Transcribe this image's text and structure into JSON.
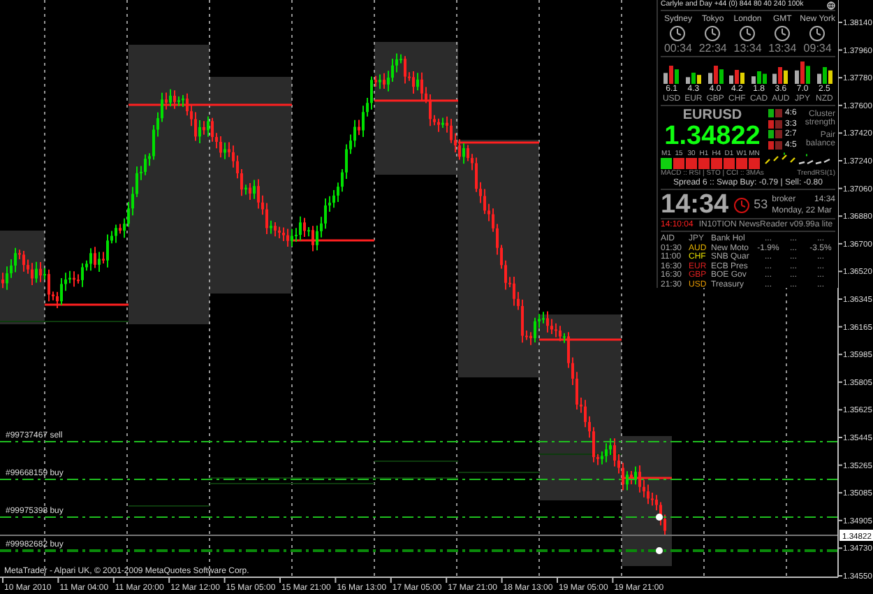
{
  "panel": {
    "header": "Carlyle and Day +44 (0) 844 80 40 240 100k",
    "clocks": [
      {
        "city": "Sydney",
        "time": "00:34"
      },
      {
        "city": "Tokyo",
        "time": "22:34"
      },
      {
        "city": "London",
        "time": "13:34"
      },
      {
        "city": "GMT",
        "time": "13:34"
      },
      {
        "city": "New York",
        "time": "09:34"
      }
    ],
    "strength": [
      {
        "value": "6.1",
        "code": "USD"
      },
      {
        "value": "4.3",
        "code": "EUR"
      },
      {
        "value": "4.0",
        "code": "GBP"
      },
      {
        "value": "4.2",
        "code": "CHF"
      },
      {
        "value": "1.8",
        "code": "CAD"
      },
      {
        "value": "3.6",
        "code": "AUD"
      },
      {
        "value": "7.0",
        "code": "JPY"
      },
      {
        "value": "2.5",
        "code": "NZD"
      }
    ],
    "pair": "EURUSD",
    "bid": "1.34822",
    "cluster": [
      {
        "ratio": "4:6"
      },
      {
        "ratio": "3:3"
      },
      {
        "ratio": "2:7"
      },
      {
        "ratio": "4:5"
      }
    ],
    "cluster_labels": [
      "Cluster strength",
      "Pair balance"
    ],
    "timeframes": [
      {
        "label": "M1",
        "bullish": true
      },
      {
        "label": "15",
        "bullish": false
      },
      {
        "label": "30",
        "bullish": false
      },
      {
        "label": "H1",
        "bullish": false
      },
      {
        "label": "H4",
        "bullish": false
      },
      {
        "label": "D1",
        "bullish": false
      },
      {
        "label": "W1",
        "bullish": false
      },
      {
        "label": "MN",
        "bullish": false
      }
    ],
    "indicators": "MACD :: RSI | STO | CCI :: 3MAs",
    "trend_label": "TrendRSI(1)",
    "spread": "Spread 6 :: Swap Buy: -0.79 | Sell: -0.80",
    "local_time": "14:34",
    "seconds": "53",
    "broker_label": "broker",
    "broker_time": "14:34",
    "date": "Monday, 22 Mar",
    "news_time": "14:10:04",
    "news_title": "IN10TION NewsReader v09.99a lite",
    "news": [
      {
        "time": "AID",
        "currency": "JPY",
        "color": "#a0a0a0",
        "event": "Bank Hol",
        "values": [
          "...",
          "...",
          "..."
        ]
      },
      {
        "time": "01:30",
        "currency": "AUD",
        "color": "#e8b400",
        "event": "New Moto",
        "values": [
          "-1.9%",
          "...",
          "-3.5%"
        ]
      },
      {
        "time": "11:00",
        "currency": "CHF",
        "color": "#e8e000",
        "event": "SNB Quar",
        "values": [
          "...",
          "...",
          "..."
        ]
      },
      {
        "time": "16:30",
        "currency": "EUR",
        "color": "#e02020",
        "event": "ECB Pres",
        "values": [
          "...",
          "...",
          "..."
        ]
      },
      {
        "time": "16:30",
        "currency": "GBP",
        "color": "#e02020",
        "event": "BOE Gov",
        "values": [
          "...",
          "...",
          "..."
        ]
      },
      {
        "time": "21:30",
        "currency": "USD",
        "color": "#e89a00",
        "event": "Treasury",
        "values": [
          "...",
          "...",
          "..."
        ]
      }
    ]
  },
  "orders": [
    {
      "label": "#99737467 sell"
    },
    {
      "label": "#99668159 buy"
    },
    {
      "label": "#99975398 buy"
    },
    {
      "label": "#99982682 buy"
    }
  ],
  "copyright": "MetaTrader - Alpari UK, © 2001-2009 MetaQuotes Software Corp.",
  "price_axis": {
    "ticks": [
      "1.38140",
      "1.37960",
      "1.37780",
      "1.37600",
      "1.37420",
      "1.37240",
      "1.37060",
      "1.36880",
      "1.36700",
      "1.36520",
      "1.36345",
      "1.36165",
      "1.35985",
      "1.35805",
      "1.35625",
      "1.35445",
      "1.35265",
      "1.35085",
      "1.34905",
      "1.34730",
      "1.34550"
    ],
    "current": "1.34822"
  },
  "time_axis": {
    "ticks": [
      "10 Mar 2010",
      "11 Mar 04:00",
      "11 Mar 20:00",
      "12 Mar 12:00",
      "15 Mar 05:00",
      "15 Mar 21:00",
      "16 Mar 13:00",
      "17 Mar 05:00",
      "17 Mar 21:00",
      "18 Mar 13:00",
      "19 Mar 05:00",
      "19 Mar 21:00"
    ]
  }
}
